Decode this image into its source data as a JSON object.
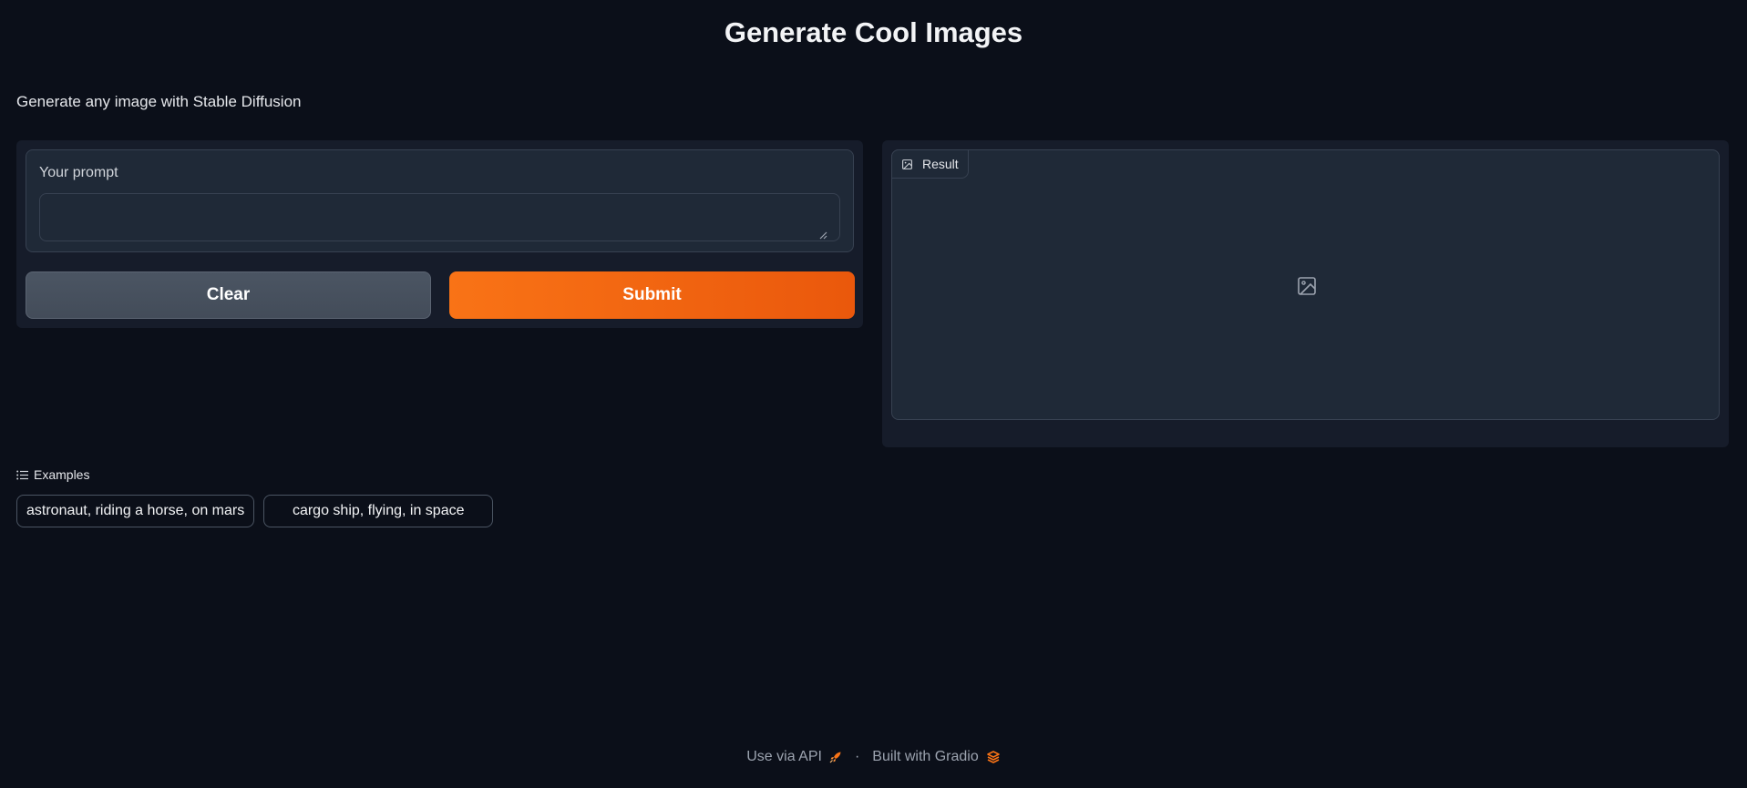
{
  "header": {
    "title": "Generate Cool Images",
    "description": "Generate any image with Stable Diffusion"
  },
  "prompt": {
    "label": "Your prompt",
    "value": "",
    "placeholder": ""
  },
  "buttons": {
    "clear_label": "Clear",
    "submit_label": "Submit"
  },
  "result": {
    "label": "Result",
    "icon": "image-icon"
  },
  "examples": {
    "label": "Examples",
    "items": [
      "astronaut, riding a horse, on mars",
      "cargo ship, flying, in space"
    ]
  },
  "footer": {
    "api_label": "Use via API",
    "separator": "·",
    "built_with_label": "Built with Gradio"
  },
  "colors": {
    "background": "#0b0f19",
    "panel": "#1f2937",
    "accent": "#f97316",
    "secondary_button": "#4b5563"
  }
}
